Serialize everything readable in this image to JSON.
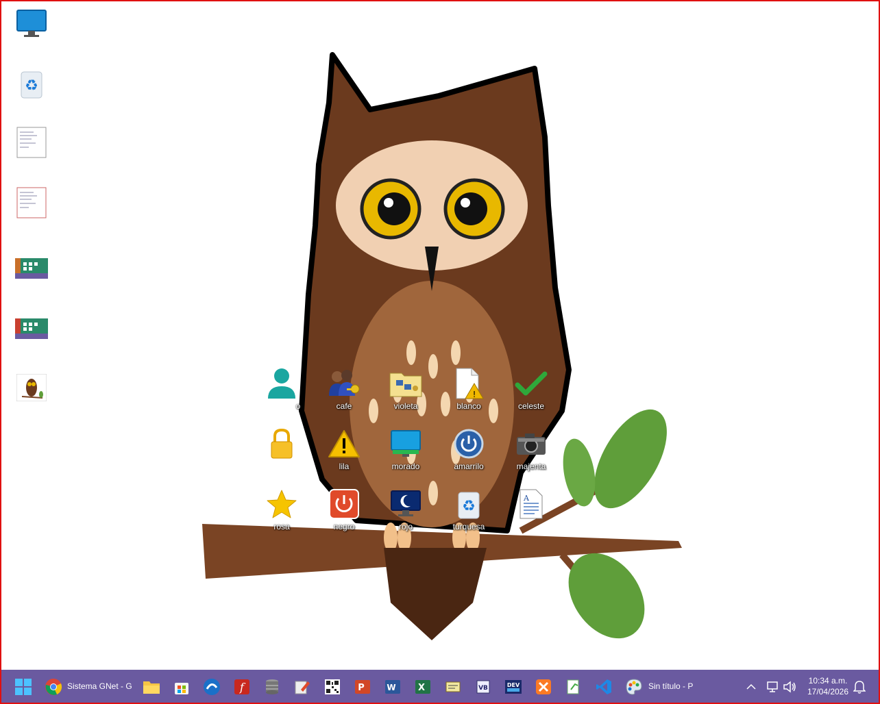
{
  "desktop": {
    "grid_icons": [
      {
        "label": "o",
        "icon": "user-icon"
      },
      {
        "label": "cafe",
        "icon": "people-key-icon"
      },
      {
        "label": "violeta",
        "icon": "shared-folder-icon"
      },
      {
        "label": "blanco",
        "icon": "file-warning-icon"
      },
      {
        "label": "celeste",
        "icon": "checkmark-icon"
      },
      {
        "label": "",
        "icon": "lock-icon"
      },
      {
        "label": "lila",
        "icon": "warning-icon"
      },
      {
        "label": "morado",
        "icon": "monitor-icon"
      },
      {
        "label": "amarrilo",
        "icon": "power-icon"
      },
      {
        "label": "majenta",
        "icon": "camera-icon"
      },
      {
        "label": "rosa",
        "icon": "star-icon"
      },
      {
        "label": "negro",
        "icon": "shutdown-icon"
      },
      {
        "label": "rojo",
        "icon": "sleep-monitor-icon"
      },
      {
        "label": "turquesa",
        "icon": "recycle-bin-icon"
      },
      {
        "label": "",
        "icon": "text-document-icon"
      }
    ]
  },
  "taskbar": {
    "chrome_window_title": "Sistema GNet - G",
    "paint_window_title": "Sin título - P",
    "time": "10:34 a.m.",
    "date": "17/04/2026"
  },
  "colors": {
    "taskbar": "#6a5aa0",
    "frame": "#e01010"
  }
}
